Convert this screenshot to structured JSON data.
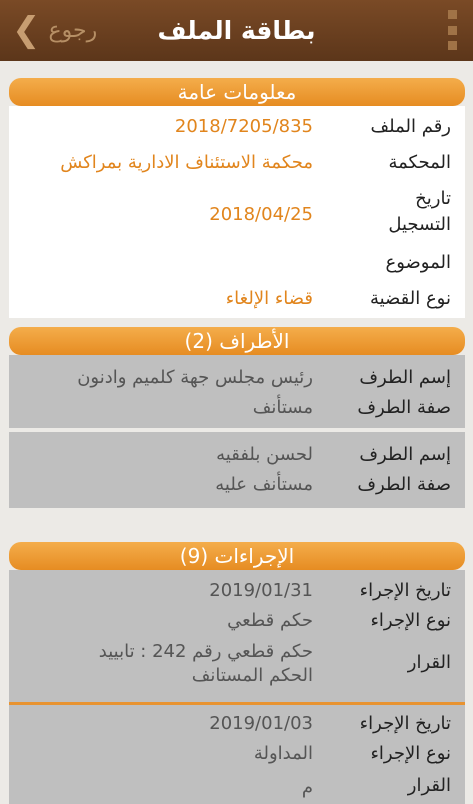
{
  "header": {
    "title": "بطاقة الملف",
    "back_label": "رجوع",
    "back_glyph": "❮"
  },
  "general": {
    "title": "معلومات عامة",
    "rows": [
      {
        "label": "رقم الملف",
        "value": "2018/7205/835"
      },
      {
        "label": "المحكمة",
        "value": "محكمة الاستئناف الادارية بمراكش"
      },
      {
        "label": "تاريخ\nالتسجيل",
        "value": "2018/04/25"
      },
      {
        "label": "الموضوع",
        "value": ""
      },
      {
        "label": "نوع القضية",
        "value": "قضاء الإلغاء"
      }
    ]
  },
  "parties": {
    "title": "الأطراف (2)",
    "items": [
      {
        "name_label": "إسم الطرف",
        "name": "رئيس مجلس جهة كلميم وادنون",
        "role_label": "صفة الطرف",
        "role": "مستأنف"
      },
      {
        "name_label": "إسم الطرف",
        "name": "لحسن بلفقيه",
        "role_label": "صفة الطرف",
        "role": "مستأنف عليه"
      }
    ]
  },
  "procedures": {
    "title": "الإجراءات (9)",
    "items": [
      {
        "date_label": "تاريخ الإجراء",
        "date": "2019/01/31",
        "type_label": "نوع الإجراء",
        "type": "حكم قطعي",
        "decision_label": "القرار",
        "decision": "حكم قطعي رقم  242 : تابييد\nالحكم المستانف"
      },
      {
        "date_label": "تاريخ الإجراء",
        "date": "2019/01/03",
        "type_label": "نوع الإجراء",
        "type": "المداولة",
        "decision_label": "القرار",
        "decision": "م"
      }
    ]
  }
}
